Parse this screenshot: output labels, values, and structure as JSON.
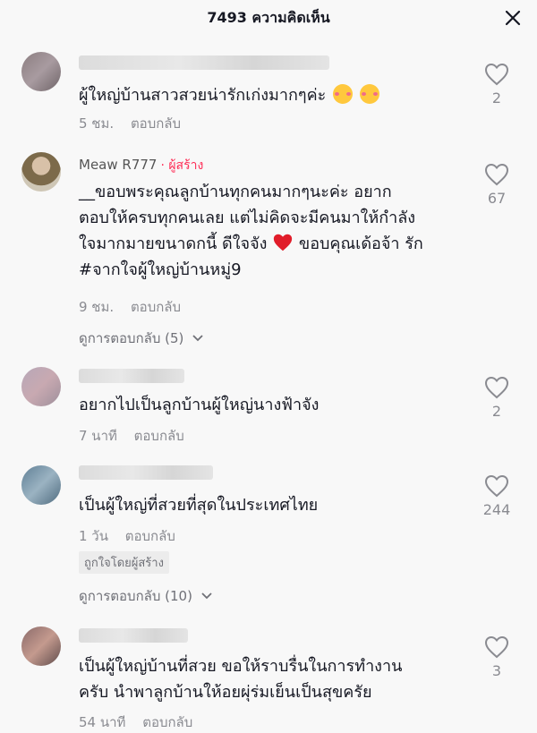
{
  "header": {
    "title": "7493 ความคิดเห็น"
  },
  "comments": [
    {
      "text": "ผู้ใหญ่บ้านสาวสวยน่ารักเก่งมากๆค่ะ",
      "time": "5 ชม.",
      "reply": "ตอบกลับ",
      "likes": "2",
      "emoji": [
        "smiling-face-with-hearts",
        "smiling-face-with-hearts"
      ]
    },
    {
      "name": "Meaw R777",
      "creator_label": "· ผู้สร้าง",
      "lines": [
        "__ขอบพระคุณลูกบ้านทุกคนมากๆนะค่ะ อยาก",
        "ตอบให้ครบทุกคนเลย แต่ไม่คิดจะมีคนมาให้กำลัง",
        "ใจมากมายขนาดกนี้ ดีใจจัง",
        "ขอบคุณเด้อจ้า รัก",
        "#จากใจผู้ใหญ่บ้านหมู่9"
      ],
      "time": "9 ชม.",
      "reply": "ตอบกลับ",
      "likes": "67",
      "view_replies": "ดูการตอบกลับ (5)"
    },
    {
      "text": "อยากไปเป็นลูกบ้านผู้ใหญ่นางฟ้าจัง",
      "time": "7 นาที",
      "reply": "ตอบกลับ",
      "likes": "2"
    },
    {
      "text": "เป็นผู้ใหญ่ที่สวยที่สุดในประเทศไทย",
      "time": "1 วัน",
      "reply": "ตอบกลับ",
      "likes": "244",
      "liked_by_creator": "ถูกใจโดยผู้สร้าง",
      "view_replies": "ดูการตอบกลับ (10)"
    },
    {
      "lines": [
        "เป็นผู้ใหญ่บ้านที่สวย ขอให้ราบรื่นในการทำงาน",
        "ครับ นำพาลูกบ้านให้อยผุ่ร่มเย็นเป็นสุขครัย"
      ],
      "time": "54 นาที",
      "reply": "ตอบกลับ",
      "likes": "3"
    }
  ],
  "colors": {
    "creator": "#fe2c55",
    "heart": "#e11d2a",
    "secondary": "#8a8b91"
  }
}
